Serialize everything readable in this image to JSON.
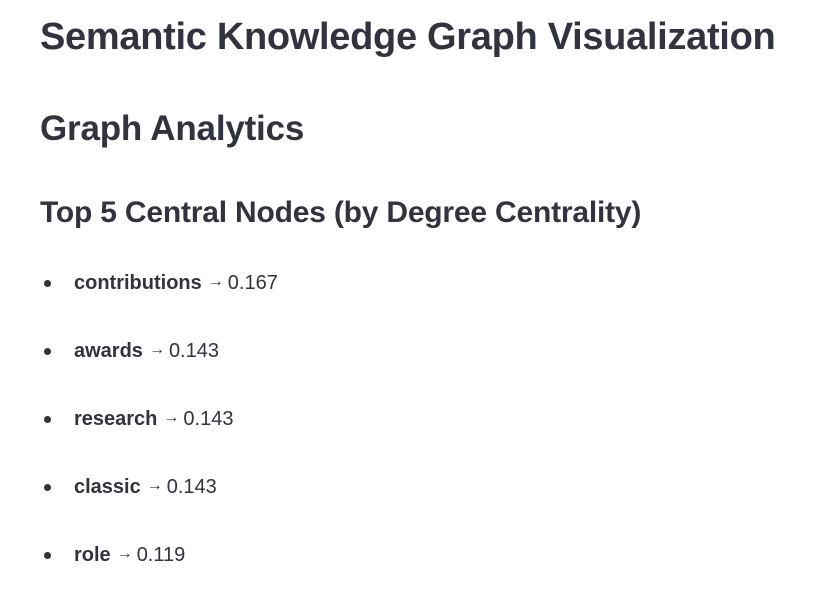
{
  "page": {
    "title": "Semantic Knowledge Graph Visualization",
    "section_title": "Graph Analytics",
    "subsection_title": "Top 5 Central Nodes (by Degree Centrality)",
    "arrow_glyph": "→"
  },
  "central_nodes": [
    {
      "name": "contributions",
      "score": "0.167"
    },
    {
      "name": "awards",
      "score": "0.143"
    },
    {
      "name": "research",
      "score": "0.143"
    },
    {
      "name": "classic",
      "score": "0.143"
    },
    {
      "name": "role",
      "score": "0.119"
    }
  ],
  "colors": {
    "text": "#31333f",
    "background": "#ffffff"
  }
}
